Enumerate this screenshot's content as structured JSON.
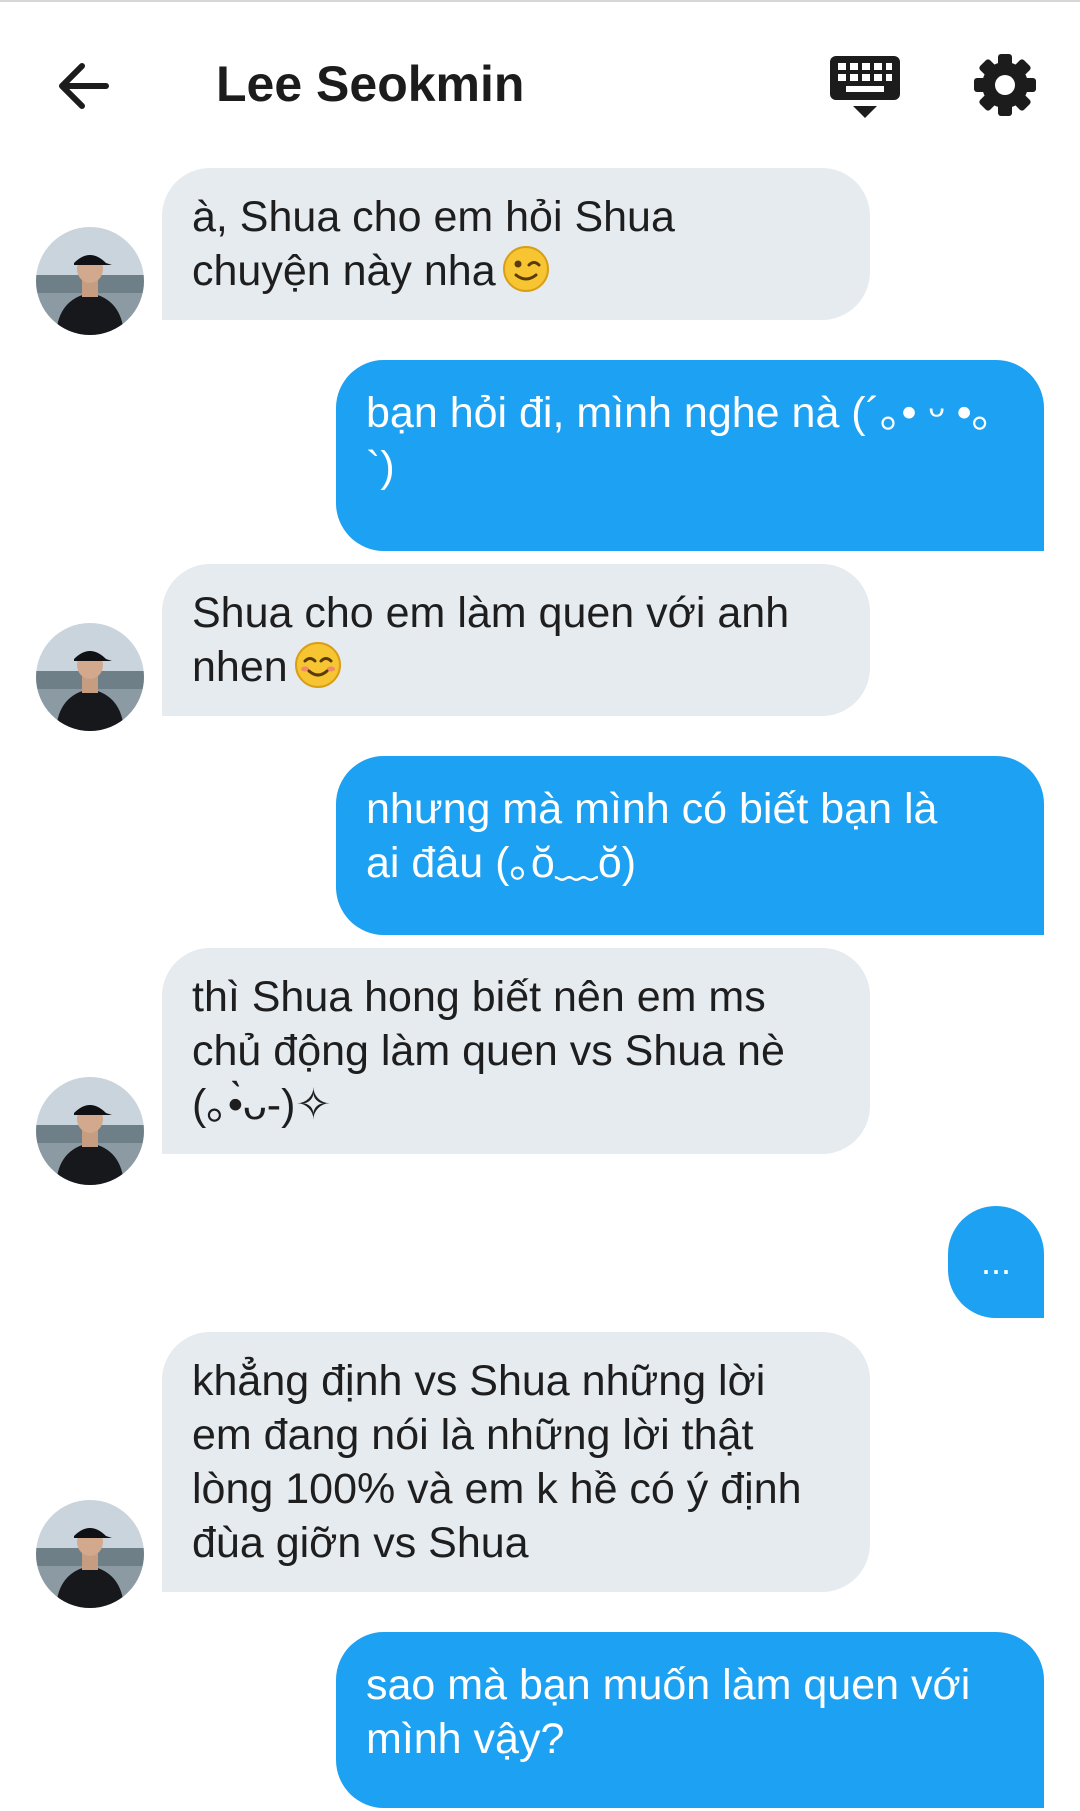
{
  "header": {
    "title": "Lee Seokmin",
    "icons": [
      "back-arrow-icon",
      "keyboard-icon",
      "gear-icon"
    ]
  },
  "colors": {
    "incoming_bubble": "#e6ebf0",
    "outgoing_bubble": "#1da1f2",
    "outgoing_text": "#ffffff",
    "incoming_text": "#1e1e1e"
  },
  "messages": [
    {
      "from": "contact",
      "text": "à, Shua cho em hỏi Shua\nchuyện này nha",
      "emoji": "winking-face-emoji"
    },
    {
      "from": "me",
      "text": "bạn hỏi đi, mình nghe nà (´｡• ᵕ •｡`)"
    },
    {
      "from": "contact",
      "text": "Shua cho em làm quen với anh\nnhen",
      "emoji": "smiling-face-emoji"
    },
    {
      "from": "me",
      "text": "nhưng mà mình có biết bạn là\nai đâu (｡ŏ﹏ŏ)"
    },
    {
      "from": "contact",
      "text": "thì Shua hong biết nên em ms\nchủ động làm quen vs Shua nè\n(｡•̀ᴗ-)✧"
    },
    {
      "from": "me",
      "text": "..."
    },
    {
      "from": "contact",
      "text": "khẳng định vs Shua những lời\nem đang nói là những lời thật\nlòng 100% và em k hề có ý định\nđùa giỡn vs Shua"
    },
    {
      "from": "me",
      "text": "sao mà bạn muốn làm quen với\nmình vậy?"
    }
  ]
}
